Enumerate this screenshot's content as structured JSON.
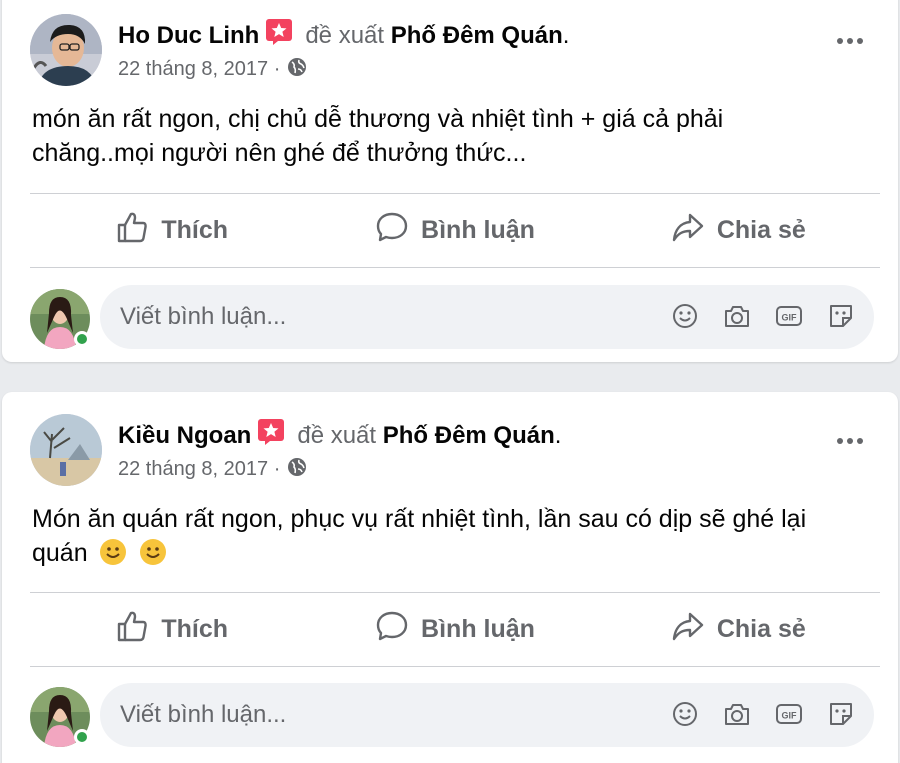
{
  "posts": [
    {
      "author": "Ho Duc Linh",
      "verb": "đề xuất",
      "place": "Phố Đêm Quán",
      "period": ".",
      "date": "22 tháng 8, 2017 ·",
      "text": "món ăn rất ngon, chị chủ dễ thương và nhiệt tình + giá cả phải chăng..mọi người nên ghé để thưởng thức..."
    },
    {
      "author": "Kiều Ngoan",
      "verb": "đề xuất",
      "place": "Phố Đêm Quán",
      "period": ".",
      "date": "22 tháng 8, 2017 ·",
      "text": "Món ăn quán rất ngon, phục vụ rất nhiệt tình, lần sau có dịp sẽ ghé lại quán"
    }
  ],
  "actions": {
    "like": "Thích",
    "comment": "Bình luận",
    "share": "Chia sẻ"
  },
  "comment_box": {
    "placeholder": "Viết bình luận..."
  },
  "icons": {
    "recommend_badge": "recommend-badge-icon",
    "audience": "globe-icon",
    "more": "more-options-icon",
    "like": "like-icon",
    "comment": "comment-icon",
    "share": "share-icon",
    "emoji": "emoji-icon",
    "camera": "camera-icon",
    "gif": "gif-icon",
    "sticker": "sticker-icon"
  },
  "colors": {
    "badge": "#f3425f",
    "secondary_text": "#65676b",
    "online": "#31a24c",
    "comment_bg": "#f0f2f5"
  }
}
